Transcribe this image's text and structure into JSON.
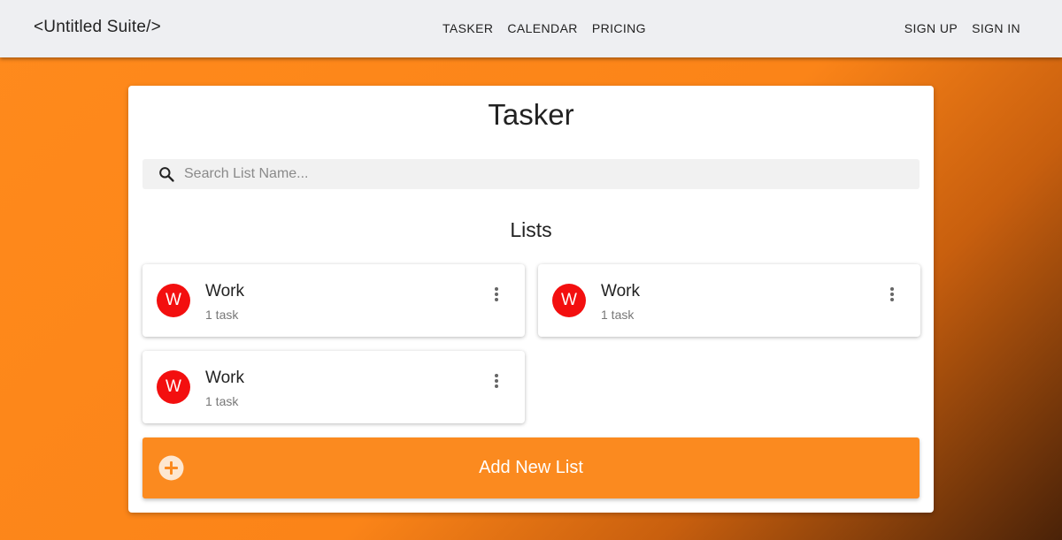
{
  "navbar": {
    "brand": "<Untitled Suite/>",
    "center_links": [
      "TASKER",
      "CALENDAR",
      "PRICING"
    ],
    "right_links": [
      "SIGN UP",
      "SIGN IN"
    ]
  },
  "main": {
    "title": "Tasker",
    "search": {
      "placeholder": "Search List Name...",
      "icon": "search-icon"
    },
    "lists_heading": "Lists",
    "lists": [
      {
        "initial": "W",
        "name": "Work",
        "count": "1 task"
      },
      {
        "initial": "W",
        "name": "Work",
        "count": "1 task"
      },
      {
        "initial": "W",
        "name": "Work",
        "count": "1 task"
      }
    ],
    "add_button": {
      "label": "Add New List",
      "icon": "plus-circle-icon"
    }
  },
  "colors": {
    "accent": "#fb8a1f",
    "avatar": "#f30f0f",
    "navbar_bg": "#eeeff2"
  }
}
